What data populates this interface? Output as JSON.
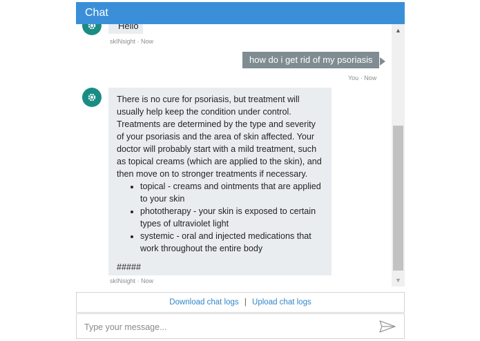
{
  "header": {
    "title": "Chat"
  },
  "messages": [
    {
      "sender": "bot",
      "text": "Hello",
      "meta": "skINsight · Now"
    },
    {
      "sender": "user",
      "text": "how do i get rid of my psoriasis",
      "meta": "You · Now"
    },
    {
      "sender": "bot",
      "paragraph": "There is no cure for psoriasis, but treatment will usually help keep the condition under control. Treatments are determined by the type and severity of your psoriasis and the area of skin affected. Your doctor will probably start with a mild treatment, such as topical creams (which are applied to the skin), and then move on to stronger treatments if necessary.",
      "bullets": [
        "topical - creams and ointments that are applied to your skin",
        "phototherapy - your skin is exposed to certain types of ultraviolet light",
        "systemic - oral and injected medications that work throughout the entire body"
      ],
      "trailer": "#####",
      "meta": "skINsight · Now"
    }
  ],
  "footer": {
    "download_label": "Download chat logs",
    "separator": "|",
    "upload_label": "Upload chat logs"
  },
  "input": {
    "placeholder": "Type your message...",
    "value": ""
  },
  "icons": {
    "avatar": "gear-icon",
    "send": "send-icon",
    "scroll_up": "arrow-up-icon",
    "scroll_down": "arrow-down-icon"
  },
  "colors": {
    "header": "#3b8fd9",
    "avatar": "#1a8c84",
    "user_bubble": "#7f8c91",
    "bot_bubble": "#eaedf0",
    "link": "#2f86c8"
  }
}
